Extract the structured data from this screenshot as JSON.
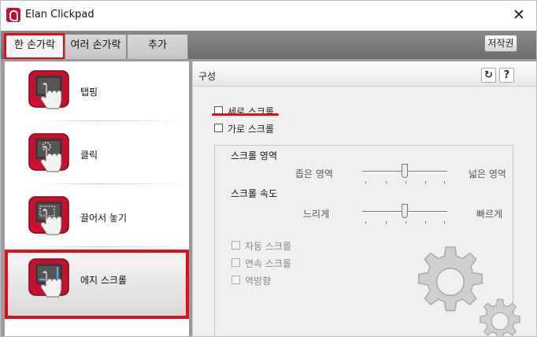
{
  "window": {
    "title": "Elan Clickpad",
    "close_glyph": "✕"
  },
  "tabs": [
    {
      "label": "한 손가락",
      "active": true
    },
    {
      "label": "여러 손가락",
      "active": false
    },
    {
      "label": "추가",
      "active": false
    }
  ],
  "copyright_label": "저작권",
  "nav": [
    {
      "label": "탭핑",
      "icon": "tap-icon"
    },
    {
      "label": "클릭",
      "icon": "click-icon"
    },
    {
      "label": "끌어서 놓기",
      "icon": "drag-drop-icon"
    },
    {
      "label": "에지 스크롤",
      "icon": "edge-scroll-icon",
      "selected": true
    }
  ],
  "section": {
    "title": "구성",
    "refresh_glyph": "↻",
    "help_glyph": "?"
  },
  "options": {
    "vertical_scroll": {
      "label": "세로 스크롤",
      "checked": false
    },
    "horizontal_scroll": {
      "label": "가로 스크롤",
      "checked": false
    }
  },
  "scroll_area": {
    "heading": "스크롤 영역",
    "min_label": "좁은 영역",
    "max_label": "넓은 영역",
    "value": 0.5
  },
  "scroll_speed": {
    "heading": "스크롤 속도",
    "min_label": "느리게",
    "max_label": "빠르게",
    "value": 0.5
  },
  "disabled_options": [
    {
      "label": "자동 스크롤",
      "checked": false
    },
    {
      "label": "연속 스크롤",
      "checked": false
    },
    {
      "label": "역방향",
      "checked": false
    }
  ],
  "colors": {
    "accent_red": "#e10c1c",
    "icon_red": "#c8102e",
    "tabbar": "#7a7a7a"
  }
}
